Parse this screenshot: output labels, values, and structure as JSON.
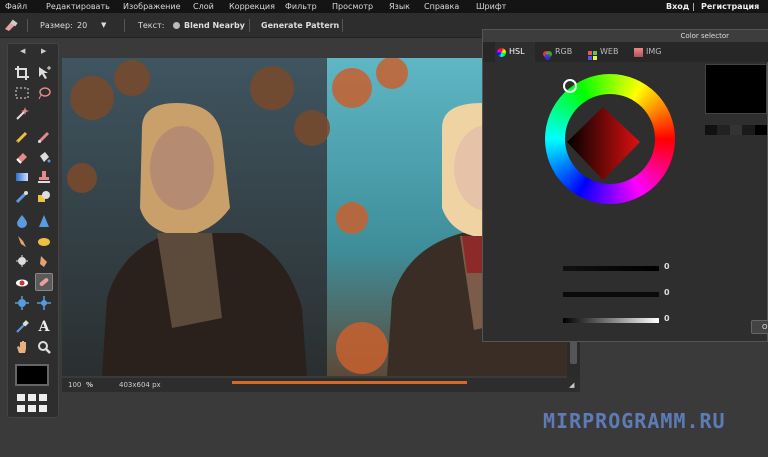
{
  "menubar": {
    "items": [
      "Файл",
      "Редактировать",
      "Изображение",
      "Слой",
      "Коррекция",
      "Фильтр",
      "Просмотр",
      "Язык",
      "Справка",
      "Шрифт"
    ],
    "login": "Вход",
    "separator": "|",
    "register": "Регистрация"
  },
  "options": {
    "size_label": "Размер:",
    "size_value": "20",
    "text_label": "Текст:",
    "blend_label": "Blend Nearby",
    "generate_label": "Generate Pattern"
  },
  "toolbox": {
    "tools": [
      "crop-icon",
      "move-icon",
      "marquee-icon",
      "lasso-icon",
      "magic-wand-icon",
      "pencil-icon",
      "brush-icon",
      "eraser-icon",
      "bucket-icon",
      "gradient-icon",
      "clone-stamp-icon",
      "color-replace-icon",
      "shape-icon",
      "blur-icon",
      "sharpen-icon",
      "smudge-icon",
      "sponge-icon",
      "burn-icon",
      "dodge-icon",
      "red-eye-icon",
      "spot-heal-icon",
      "bloat-icon",
      "pinch-icon",
      "color-picker-icon",
      "type-icon",
      "hand-icon",
      "zoom-icon"
    ]
  },
  "statusbar": {
    "zoom": "100",
    "zoom_unit": "%",
    "dimensions": "403x604 px"
  },
  "color_selector": {
    "title": "Color selector",
    "tabs": [
      "HSL",
      "RGB",
      "WEB",
      "IMG"
    ],
    "slider_values": [
      "0",
      "0",
      "0"
    ],
    "ok_label": "O",
    "current_color": "#000000"
  },
  "watermark": "MIRPROGRAMM.RU",
  "colors": {
    "menubar": "#141414",
    "panel": "#2e2e2e",
    "accent": "#5e7bb5"
  }
}
